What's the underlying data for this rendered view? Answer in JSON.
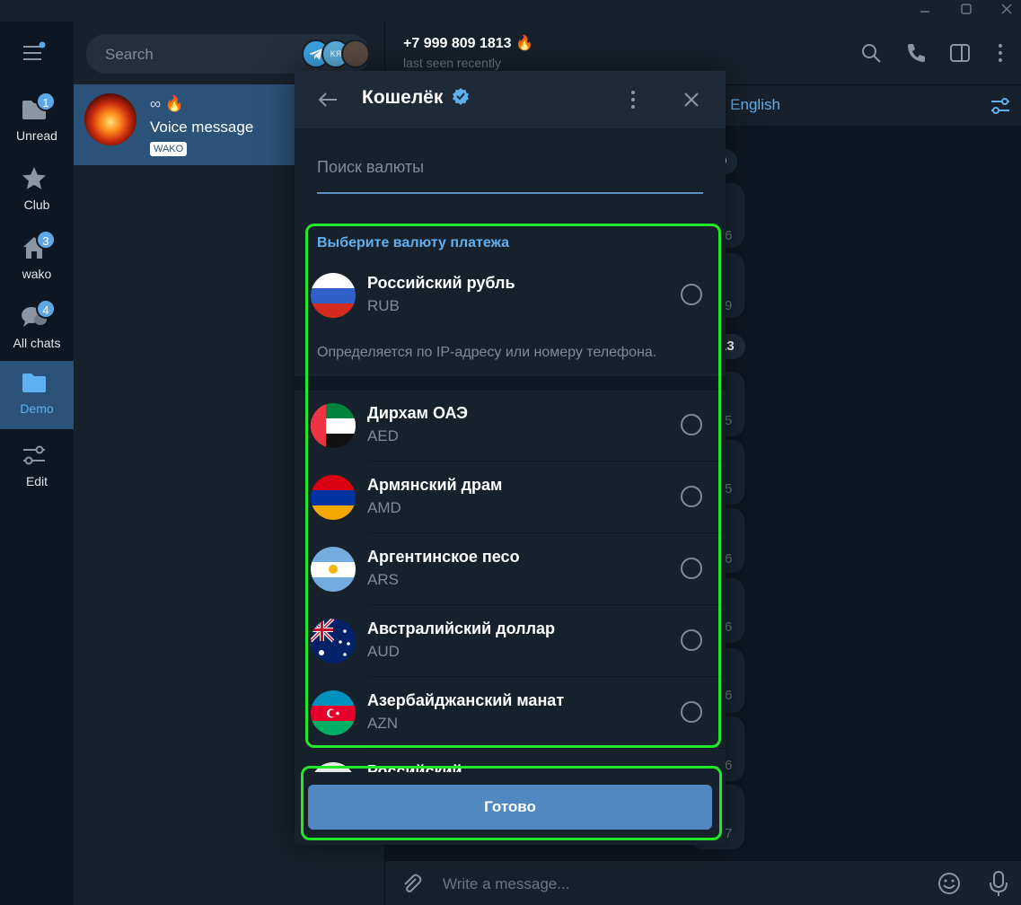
{
  "window": {
    "min": "—",
    "max": "☐",
    "close": "✕"
  },
  "rail": {
    "items": [
      {
        "label": "Unread",
        "badge": "1",
        "icon": "folder-icon"
      },
      {
        "label": "Club",
        "badge": "",
        "icon": "star-icon"
      },
      {
        "label": "wako",
        "badge": "3",
        "icon": "home-icon"
      },
      {
        "label": "All chats",
        "badge": "4",
        "icon": "chats-icon"
      },
      {
        "label": "Demo",
        "badge": "",
        "icon": "folder-icon"
      },
      {
        "label": "Edit",
        "badge": "",
        "icon": "sliders-icon"
      }
    ]
  },
  "chatlist": {
    "search_placeholder": "Search",
    "story_label": "KЯ",
    "chat": {
      "title": "∞ 🔥",
      "preview": "Voice message",
      "tag": "WAKO"
    }
  },
  "chat": {
    "phone": "+7 999 809 1813",
    "last_seen": "last seen recently",
    "translate": "o English",
    "date_pills": [
      "9",
      "13"
    ],
    "side_times": [
      "6",
      "9",
      "5",
      "5",
      "6",
      "6",
      "6",
      "6",
      "7"
    ],
    "composer_placeholder": "Write a message..."
  },
  "modal": {
    "title": "Кошелёк",
    "search_placeholder": "Поиск валюты",
    "section_title": "Выберите валюту платежа",
    "detected": {
      "name": "Российский рубль",
      "code": "RUB"
    },
    "hint": "Определяется по IP-адресу или номеру телефона.",
    "currencies": [
      {
        "name": "Дирхам ОАЭ",
        "code": "AED"
      },
      {
        "name": "Армянский драм",
        "code": "AMD"
      },
      {
        "name": "Аргентинское песо",
        "code": "ARS"
      },
      {
        "name": "Австралийский доллар",
        "code": "AUD"
      },
      {
        "name": "Азербайджанский манат",
        "code": "AZN"
      }
    ],
    "partial_row": "Российский…",
    "done_label": "Готово"
  },
  "colors": {
    "accent": "#5fb0f0",
    "button": "#5288c1",
    "highlight": "#22e82a"
  }
}
